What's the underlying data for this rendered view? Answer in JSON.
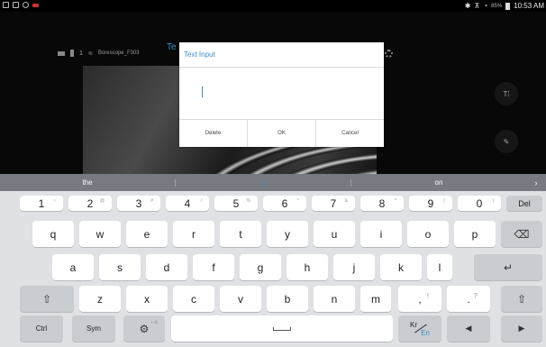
{
  "status_bar": {
    "battery_percent": "85%",
    "time": "10:53 AM",
    "left_icons": [
      "notification-icon",
      "image-icon",
      "app-icon",
      "record-icon"
    ],
    "right_icons": [
      "bluetooth-icon",
      "signal-icon",
      "wifi-icon",
      "battery-icon"
    ]
  },
  "camera_app": {
    "device_label": "Borescope_F303",
    "battery_count": "1",
    "title_fragment": "Te"
  },
  "dialog": {
    "title": "Text Input",
    "input_value": "",
    "buttons": {
      "delete": "Delete",
      "ok": "OK",
      "cancel": "Cancel"
    }
  },
  "keyboard": {
    "suggestions": [
      "the",
      "",
      "on"
    ],
    "number_row": [
      {
        "main": "1",
        "sub": "~"
      },
      {
        "main": "2",
        "sub": "@"
      },
      {
        "main": "3",
        "sub": "#"
      },
      {
        "main": "4",
        "sub": "/"
      },
      {
        "main": "5",
        "sub": "%"
      },
      {
        "main": "6",
        "sub": "^"
      },
      {
        "main": "7",
        "sub": "&"
      },
      {
        "main": "8",
        "sub": "*"
      },
      {
        "main": "9",
        "sub": "("
      },
      {
        "main": "0",
        "sub": ")"
      }
    ],
    "del_label": "Del",
    "row_q": [
      "q",
      "w",
      "e",
      "r",
      "t",
      "y",
      "u",
      "i",
      "o",
      "p"
    ],
    "row_a": [
      "a",
      "s",
      "d",
      "f",
      "g",
      "h",
      "j",
      "k",
      "l"
    ],
    "row_z": [
      "z",
      "x",
      "c",
      "v",
      "b",
      "n",
      "m"
    ],
    "punct": [
      {
        "main": ",",
        "sub": "!"
      },
      {
        "main": ".",
        "sub": "?"
      }
    ],
    "ctrl_label": "Ctrl",
    "sym_label": "Sym",
    "lang_kr": "Kr",
    "lang_en": "En",
    "settings_sub": "+-&"
  },
  "colors": {
    "accent": "#3b8fc9",
    "keyboard_bg": "#dfe1e4",
    "suggestion_bar": "#777a80"
  }
}
